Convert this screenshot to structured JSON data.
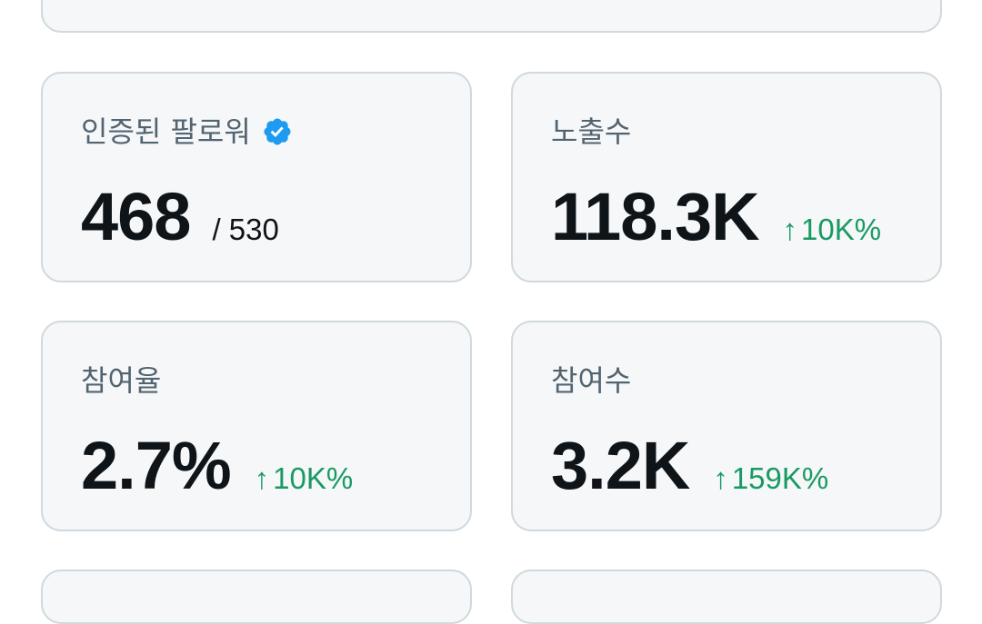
{
  "stats": {
    "verified_followers": {
      "label": "인증된 팔로워",
      "icon": "verified-badge-icon",
      "value": "468",
      "total": "/ 530"
    },
    "impressions": {
      "label": "노출수",
      "value": "118.3K",
      "change": "10K%",
      "change_icon": "arrow-up-icon"
    },
    "engagement_rate": {
      "label": "참여율",
      "value": "2.7%",
      "change": "10K%",
      "change_icon": "arrow-up-icon"
    },
    "engagements": {
      "label": "참여수",
      "value": "3.2K",
      "change": "159K%",
      "change_icon": "arrow-up-icon"
    }
  },
  "colors": {
    "card_background": "#f5f7f8",
    "card_border": "#cfd9de",
    "label_text": "#536471",
    "value_text": "#0f1419",
    "positive_change": "#1a9a63",
    "verified_badge": "#1d9bf0"
  }
}
